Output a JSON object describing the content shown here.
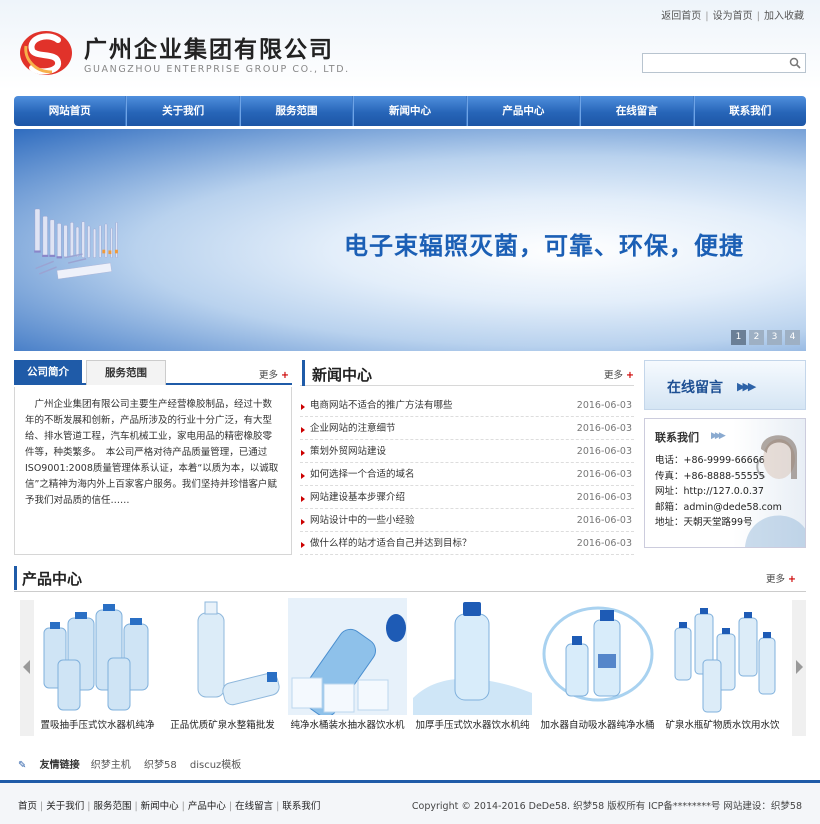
{
  "top_links": [
    "返回首页",
    "设为首页",
    "加入收藏"
  ],
  "logo": {
    "cn": "广州企业集团有限公司",
    "en": "GUANGZHOU ENTERPRISE GROUP CO., LTD."
  },
  "search": {
    "placeholder": ""
  },
  "nav": [
    "网站首页",
    "关于我们",
    "服务范围",
    "新闻中心",
    "产品中心",
    "在线留言",
    "联系我们"
  ],
  "banner": {
    "slogan": "电子束辐照灭菌，可靠、环保，便捷",
    "pages": [
      "1",
      "2",
      "3",
      "4"
    ],
    "active_page": "1"
  },
  "intro": {
    "tabs": [
      "公司简介",
      "服务范围"
    ],
    "more": "更多",
    "text": "　广州企业集团有限公司主要生产经营橡胶制品，经过十数年的不断发展和创新，产品所涉及的行业十分广泛，有大型给、排水管道工程，汽车机械工业，家电用品的精密橡胶零件等，种类繁多。　本公司严格对待产品质量管理，已通过ISO9001:2008质量管理体系认证，本着“以质为本，以诚取信”之精神为海内外上百家客户服务。我们坚持并珍惜客户赋予我们对品质的信任……"
  },
  "news": {
    "title": "新闻中心",
    "more": "更多",
    "items": [
      {
        "title": "电商网站不适合的推广方法有哪些",
        "date": "2016-06-03"
      },
      {
        "title": "企业网站的注意细节",
        "date": "2016-06-03"
      },
      {
        "title": "策划外贸网站建设",
        "date": "2016-06-03"
      },
      {
        "title": "如何选择一个合适的域名",
        "date": "2016-06-03"
      },
      {
        "title": "网站建设基本步骤介绍",
        "date": "2016-06-03"
      },
      {
        "title": "网站设计中的一些小经验",
        "date": "2016-06-03"
      },
      {
        "title": "做什么样的站才适合自己并达到目标？",
        "date": "2016-06-03"
      }
    ]
  },
  "message": {
    "title": "在线留言"
  },
  "contact": {
    "title": "联系我们",
    "rows": [
      "电话：+86-9999-66666",
      "传真：+86-8888-55555",
      "网址：http://127.0.0.37",
      "邮箱：admin@dede58.com",
      "地址：天朝天堂路99号"
    ]
  },
  "products": {
    "title": "产品中心",
    "more": "更多",
    "items": [
      "置吸抽手压式饮水器机纯净",
      "正品优质矿泉水整箱批发",
      "纯净水桶装水抽水器饮水机",
      "加厚手压式饮水器饮水机纯",
      "加水器自动吸水器纯净水桶",
      "矿泉水瓶矿物质水饮用水饮"
    ]
  },
  "friend_links": {
    "title": "友情链接",
    "items": [
      "织梦主机",
      "织梦58",
      "discuz模板"
    ]
  },
  "footer": {
    "links": [
      "首页",
      "关于我们",
      "服务范围",
      "新闻中心",
      "产品中心",
      "在线留言",
      "联系我们"
    ],
    "copyright": "Copyright © 2014-2016 DeDe58. 织梦58 版权所有  ICP备********号  网站建设：织梦58"
  },
  "colors": {
    "primary": "#1f5ba8",
    "accent": "#cc0000"
  }
}
